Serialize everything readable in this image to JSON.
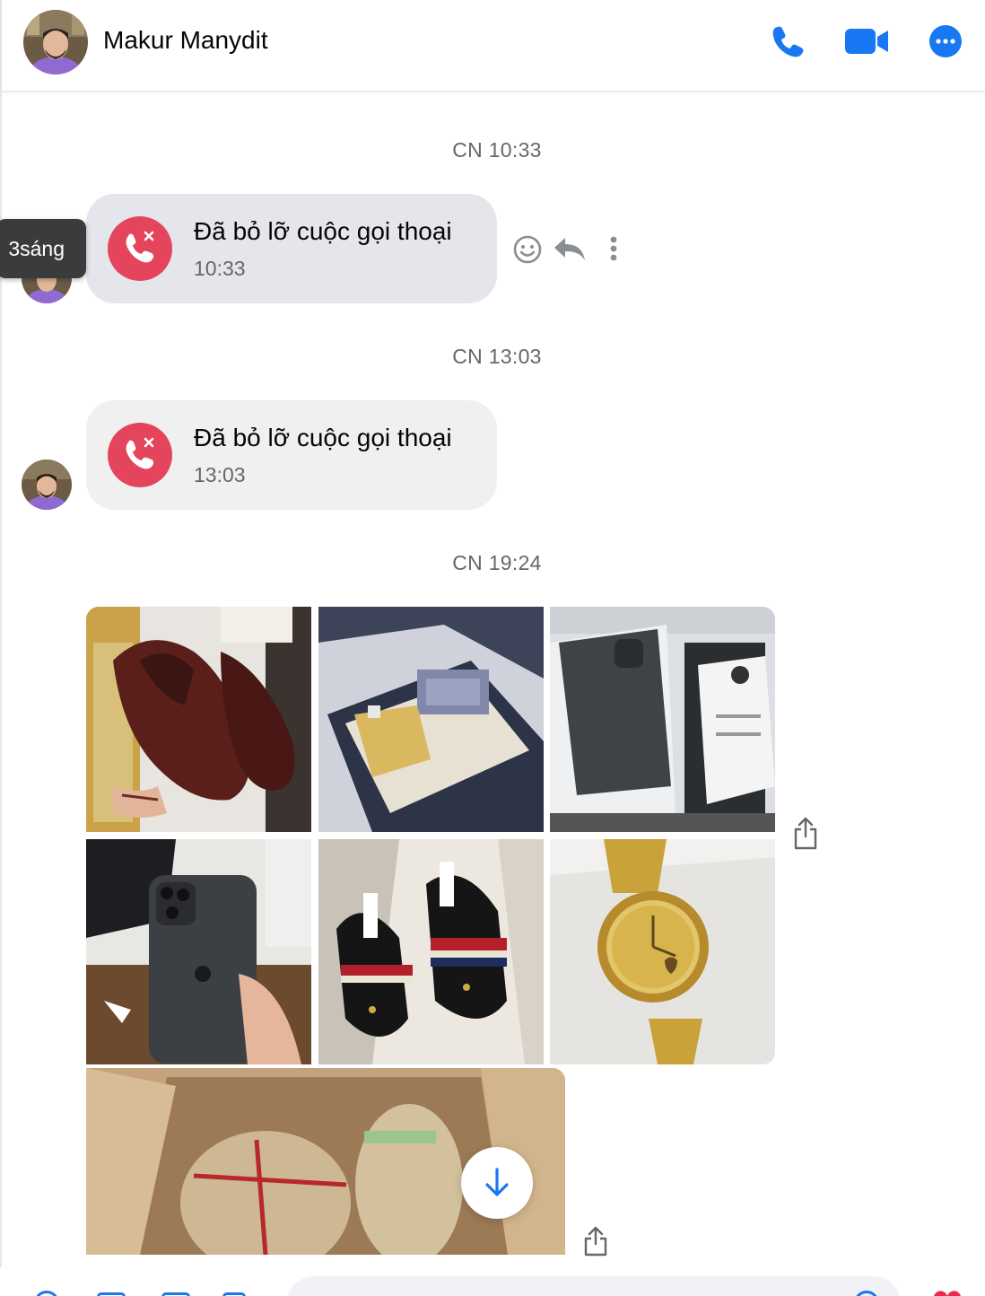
{
  "header": {
    "contact_name": "Makur Manydit",
    "icons": [
      "phone-icon",
      "video-camera-icon",
      "more-options-icon"
    ],
    "accent_color": "#1877f2"
  },
  "messages": {
    "timestamp_1": "CN 10:33",
    "call_1": {
      "title": "Đã bỏ lỡ cuộc gọi thoại",
      "time": "10:33"
    },
    "tooltip": "3sáng",
    "timestamp_2": "CN 13:03",
    "call_2": {
      "title": "Đã bỏ lỡ cuộc gọi thoại",
      "time": "13:03"
    },
    "timestamp_3": "CN 19:24",
    "missed_call_color": "#e4455c",
    "photos": [
      "brown-leather-shoes",
      "perfume-gift-box",
      "iphone-box-receipt",
      "iphone-in-hand",
      "black-striped-mules",
      "gold-watch",
      "cardboard-package"
    ]
  },
  "actions": [
    "emoji-react-icon",
    "reply-icon",
    "more-vertical-icon",
    "share-icon"
  ]
}
